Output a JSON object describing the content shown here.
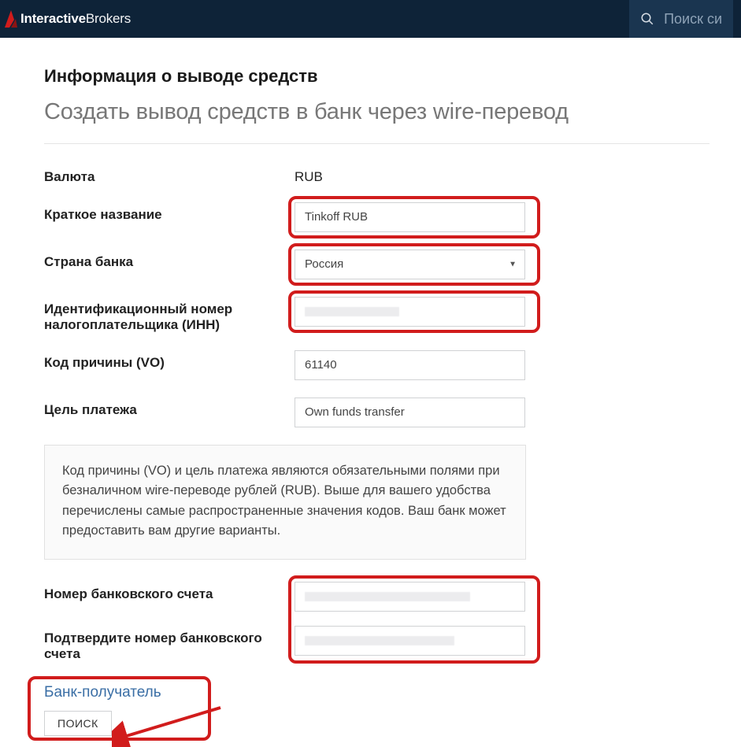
{
  "header": {
    "brand_bold": "Interactive",
    "brand_rest": "Brokers",
    "search_placeholder": "Поиск си"
  },
  "page": {
    "heading": "Информация о выводе средств",
    "subheading": "Создать вывод средств в банк через wire-перевод"
  },
  "labels": {
    "currency": "Валюта",
    "nickname": "Краткое название",
    "bank_country": "Страна банка",
    "tax_id": "Идентификационный номер налогоплательщика (ИНН)",
    "vo_code": "Код причины (VO)",
    "purpose": "Цель платежа",
    "account_no": "Номер банковского счета",
    "account_no_confirm": "Подтвердите номер банковского счета",
    "receiving_bank": "Банк-получатель",
    "search_btn": "ПОИСК"
  },
  "values": {
    "currency": "RUB",
    "nickname": "Tinkoff RUB",
    "bank_country": "Россия",
    "vo_code": "61140",
    "purpose": "Own funds transfer"
  },
  "note": "Код причины (VO) и цель платежа являются обязательными полями при безналичном wire-переводе рублей (RUB). Выше для вашего удобства перечислены самые распространенные значения кодов. Ваш банк может предоставить вам другие варианты.",
  "colors": {
    "highlight": "#d11c1c",
    "navbar": "#0e2338",
    "link": "#3a6ea5"
  }
}
